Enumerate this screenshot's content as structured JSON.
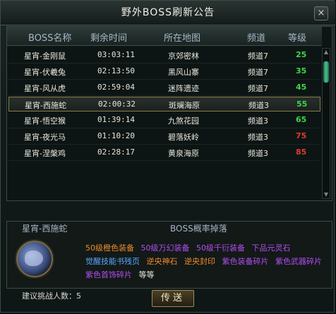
{
  "window": {
    "title": "野外BOSS刷新公告",
    "close_label": "×"
  },
  "table": {
    "headers": [
      "BOSS名称",
      "剩余时间",
      "所在地图",
      "频道",
      "等级"
    ],
    "rows": [
      {
        "name": "星宵-金刚鼠",
        "time": "03:03:11",
        "map": "京郊密林",
        "channel": "频道7",
        "level": "25",
        "level_color": "#3fd54a"
      },
      {
        "name": "星宵-伏羲兔",
        "time": "02:13:50",
        "map": "黑风山寨",
        "channel": "频道7",
        "level": "35",
        "level_color": "#3fd54a"
      },
      {
        "name": "星宵-风从虎",
        "time": "02:59:04",
        "map": "迷阵遗迹",
        "channel": "频道7",
        "level": "45",
        "level_color": "#3fd54a"
      },
      {
        "name": "星宵-西施蛇",
        "time": "02:00:32",
        "map": "斑斓海原",
        "channel": "频道3",
        "level": "55",
        "level_color": "#3fd54a",
        "selected": true
      },
      {
        "name": "星宵-悟空猴",
        "time": "01:39:14",
        "map": "九煞花园",
        "channel": "频道3",
        "level": "65",
        "level_color": "#3fd54a"
      },
      {
        "name": "星宵-夜光马",
        "time": "01:10:20",
        "map": "碧落妖岭",
        "channel": "频道3",
        "level": "75",
        "level_color": "#e03a2f"
      },
      {
        "name": "星宵-涅槃鸡",
        "time": "02:28:17",
        "map": "黄泉海原",
        "channel": "频道3",
        "level": "85",
        "level_color": "#e03a2f"
      }
    ]
  },
  "drops": {
    "boss_name": "星宵-西施蛇",
    "title": "BOSS概率掉落",
    "items": [
      {
        "label": "50级橙色装备",
        "color": "#f08a2c"
      },
      {
        "label": "50级万幻装备",
        "color": "#b24df0"
      },
      {
        "label": "50级千衍装备",
        "color": "#b24df0"
      },
      {
        "label": "下品元灵石",
        "color": "#b24df0"
      },
      {
        "label": "觉醒技能书残页",
        "color": "#5aa8ff"
      },
      {
        "label": "逆央神石",
        "color": "#f08a2c"
      },
      {
        "label": "逆央封印",
        "color": "#f08a2c"
      },
      {
        "label": "紫色装备碎片",
        "color": "#b24df0"
      },
      {
        "label": "紫色武器碎片",
        "color": "#b24df0"
      },
      {
        "label": "紫色首饰碎片",
        "color": "#b24df0"
      },
      {
        "label": "等等",
        "color": "#e8e6dc"
      }
    ]
  },
  "footer": {
    "challengers_label": "建议挑战人数：",
    "challengers_value": "5",
    "teleport_label": "传送"
  }
}
